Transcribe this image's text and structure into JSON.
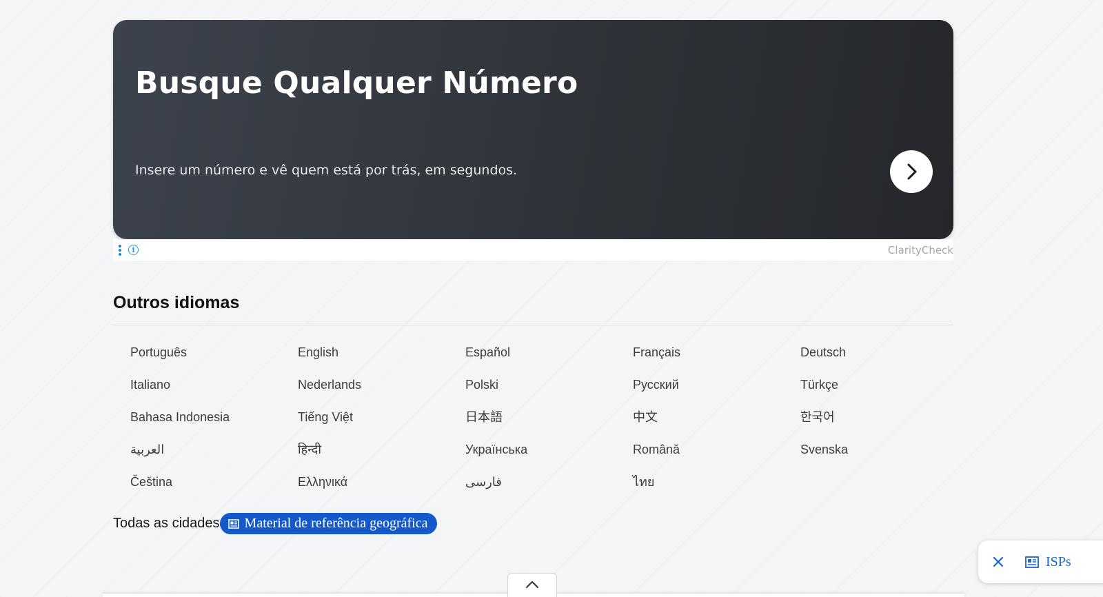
{
  "ad": {
    "title": "Busque Qualquer Número",
    "subtitle": "Insere um número e vê quem está por trás, em segundos.",
    "brand": "ClarityCheck",
    "info_glyph": "i"
  },
  "languages": {
    "heading": "Outros idiomas",
    "items": [
      "Português",
      "English",
      "Español",
      "Français",
      "Deutsch",
      "Italiano",
      "Nederlands",
      "Polski",
      "Русский",
      "Türkçe",
      "Bahasa Indonesia",
      "Tiếng Việt",
      "日本語",
      "中文",
      "한국어",
      "العربية",
      "हिन्दी",
      "Українська",
      "Română",
      "Svenska",
      "Čeština",
      "Ελληνικά",
      "فارسی",
      "ไทย"
    ]
  },
  "cities": {
    "label": "Todas as cidades",
    "chip_label": "Material de referência geográfica"
  },
  "floating": {
    "link_label": "ISPs"
  },
  "icons": {
    "ad_next": "chevron-right-icon",
    "ad_menu": "more-vertical-icon",
    "ad_info": "info-icon",
    "chip": "newspaper-icon",
    "close": "close-icon",
    "scroll_top": "chevron-up-icon"
  },
  "colors": {
    "chip_bg": "#1459cc",
    "link": "#1a65d6",
    "ad_bg": "#2f3339",
    "info": "#1e9fd6"
  }
}
